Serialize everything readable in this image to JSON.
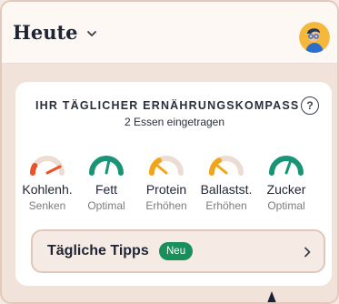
{
  "header": {
    "title": "Heute",
    "dropdown_icon": "chevron-down-icon",
    "avatar_icon": "avatar-icon"
  },
  "compass": {
    "title": "IHR TÄGLICHER ERNÄHRUNGSKOMPASS",
    "help_label": "?",
    "subtitle": "2 Essen eingetragen",
    "metrics": [
      {
        "label": "Kohlenh.",
        "status": "Senken",
        "color": "#e8542a"
      },
      {
        "label": "Fett",
        "status": "Optimal",
        "color": "#1a9476"
      },
      {
        "label": "Protein",
        "status": "Erhöhen",
        "color": "#f2a516"
      },
      {
        "label": "Ballastst.",
        "status": "Erhöhen",
        "color": "#f2a516"
      },
      {
        "label": "Zucker",
        "status": "Optimal",
        "color": "#1a9476"
      }
    ]
  },
  "tips": {
    "label": "Tägliche Tipps",
    "badge": "Neu",
    "arrow_icon": "chevron-right-icon"
  },
  "colors": {
    "accent_green": "#198f5c",
    "gauge_track": "#ecdcd3"
  }
}
